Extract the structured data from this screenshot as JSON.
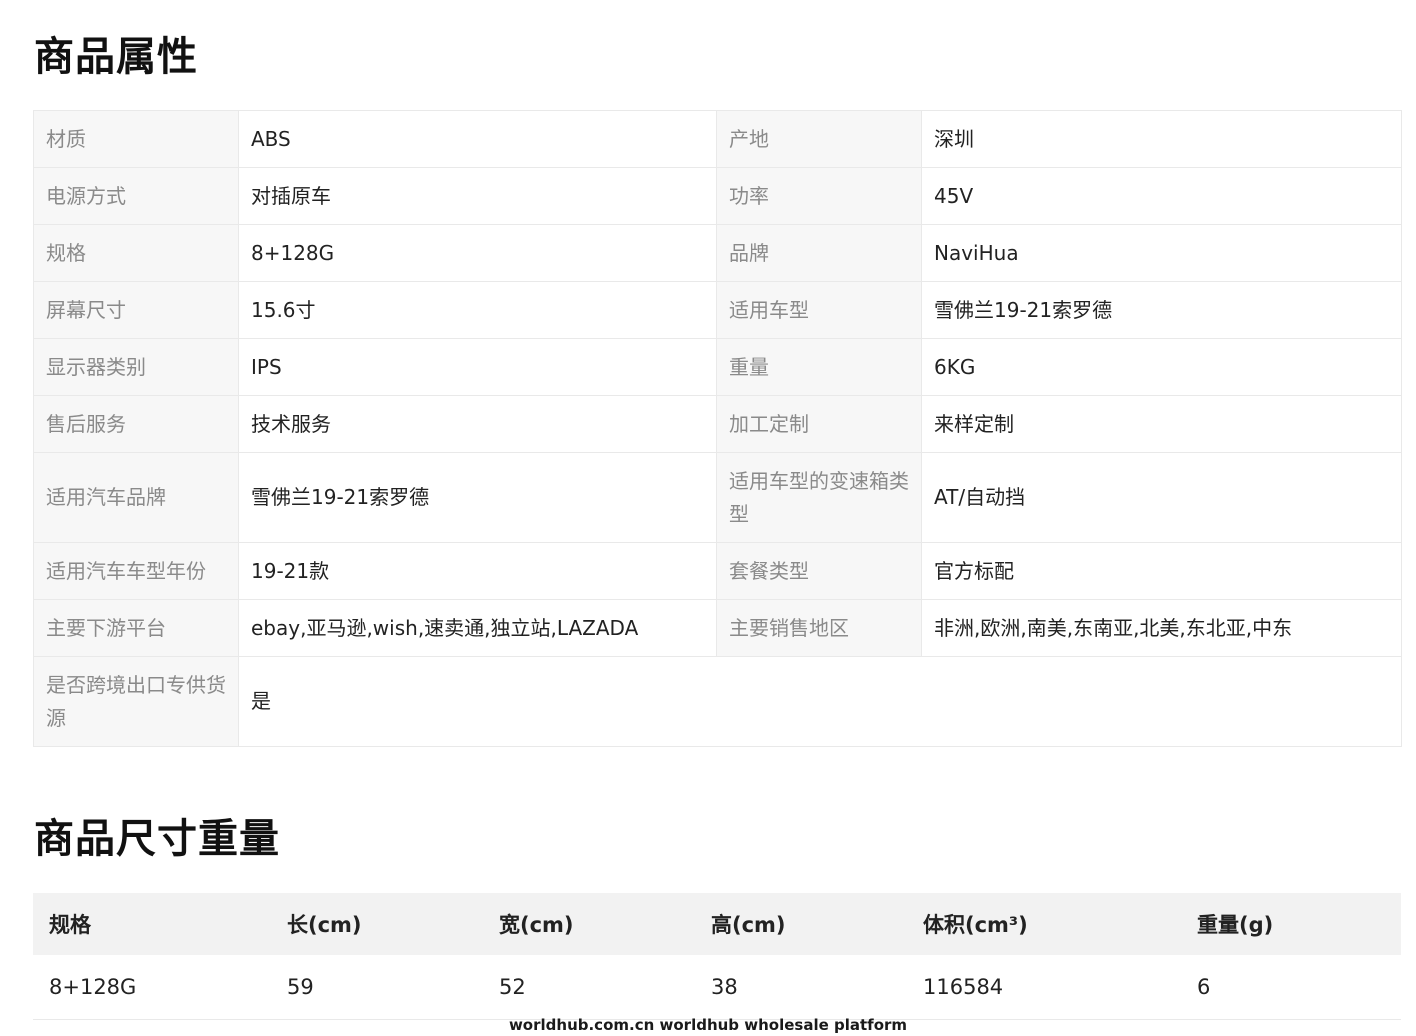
{
  "sections": {
    "attributes_title": "商品属性",
    "size_title": "商品尺寸重量"
  },
  "attributes": {
    "rows": [
      {
        "k1": "材质",
        "v1": "ABS",
        "k2": "产地",
        "v2": "深圳"
      },
      {
        "k1": "电源方式",
        "v1": "对插原车",
        "k2": "功率",
        "v2": "45V"
      },
      {
        "k1": "规格",
        "v1": "8+128G",
        "k2": "品牌",
        "v2": "NaviHua"
      },
      {
        "k1": "屏幕尺寸",
        "v1": "15.6寸",
        "k2": "适用车型",
        "v2": "雪佛兰19-21索罗德"
      },
      {
        "k1": "显示器类别",
        "v1": "IPS",
        "k2": "重量",
        "v2": "6KG"
      },
      {
        "k1": "售后服务",
        "v1": "技术服务",
        "k2": "加工定制",
        "v2": "来样定制"
      },
      {
        "k1": "适用汽车品牌",
        "v1": "雪佛兰19-21索罗德",
        "k2": "适用车型的变速箱类型",
        "v2": "AT/自动挡"
      },
      {
        "k1": "适用汽车车型年份",
        "v1": "19-21款",
        "k2": "套餐类型",
        "v2": "官方标配"
      },
      {
        "k1": "主要下游平台",
        "v1": "ebay,亚马逊,wish,速卖通,独立站,LAZADA",
        "k2": "主要销售地区",
        "v2": "非洲,欧洲,南美,东南亚,北美,东北亚,中东"
      },
      {
        "k1": "是否跨境出口专供货源",
        "v1": "是"
      }
    ]
  },
  "size_table": {
    "headers": [
      "规格",
      "长(cm)",
      "宽(cm)",
      "高(cm)",
      "体积(cm³)",
      "重量(g)"
    ],
    "rows": [
      [
        "8+128G",
        "59",
        "52",
        "38",
        "116584",
        "6"
      ]
    ]
  },
  "watermark": "worldhub.com.cn worldhub wholesale platform"
}
